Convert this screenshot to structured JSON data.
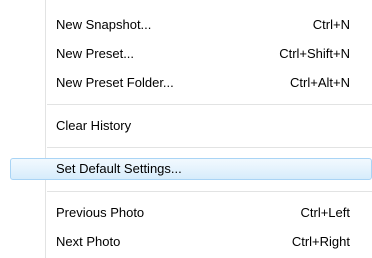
{
  "menu": {
    "groups": [
      {
        "items": [
          {
            "label": "New Snapshot...",
            "shortcut": "Ctrl+N"
          },
          {
            "label": "New Preset...",
            "shortcut": "Ctrl+Shift+N"
          },
          {
            "label": "New Preset Folder...",
            "shortcut": "Ctrl+Alt+N"
          }
        ]
      },
      {
        "items": [
          {
            "label": "Clear History",
            "shortcut": ""
          }
        ]
      },
      {
        "items": [
          {
            "label": "Set Default Settings...",
            "shortcut": "",
            "highlighted": true
          }
        ]
      },
      {
        "items": [
          {
            "label": "Previous Photo",
            "shortcut": "Ctrl+Left"
          },
          {
            "label": "Next Photo",
            "shortcut": "Ctrl+Right"
          }
        ]
      }
    ]
  },
  "colors": {
    "highlight_border": "#a9d4f5",
    "highlight_fill": "#e5f3fd",
    "separator": "#e2e3e3"
  }
}
